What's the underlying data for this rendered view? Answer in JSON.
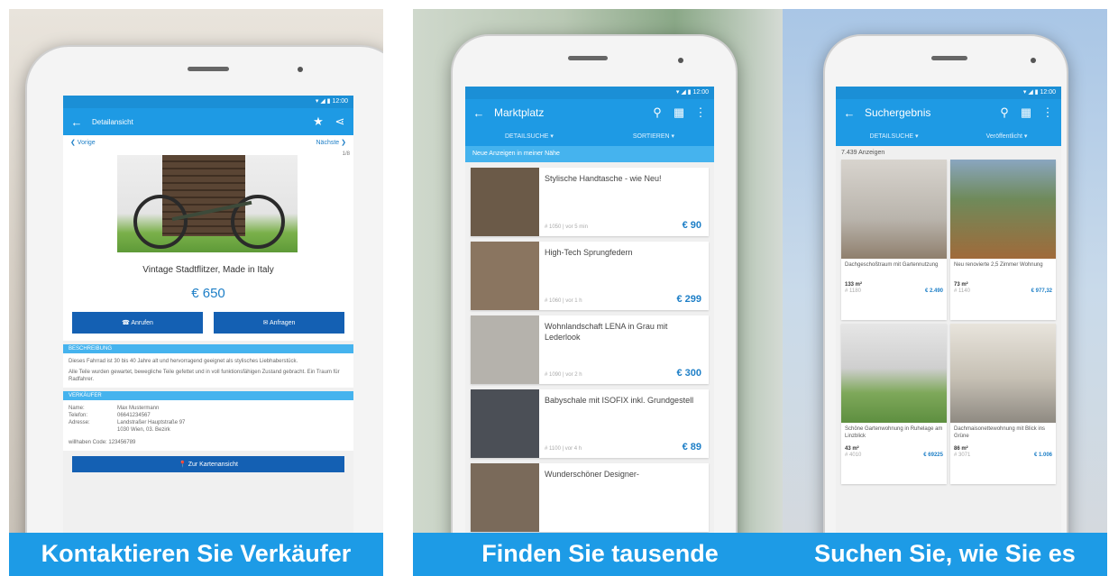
{
  "panels": [
    {
      "caption": "Kontaktieren Sie Verkäufer",
      "statusbar": "▾ ◢ ▮ 12:00",
      "toolbar": {
        "title": "Detailansicht"
      },
      "nav": {
        "prev": "❮ Vorige",
        "next": "Nächste ❯",
        "counter": "1/8"
      },
      "title": "Vintage Stadtflitzer, Made in Italy",
      "price": "€ 650",
      "buttons": {
        "call": "☎ Anrufen",
        "mail": "✉ Anfragen"
      },
      "section1": "BESCHREIBUNG",
      "description": [
        "Dieses Fahrrad ist 30 bis 40 Jahre alt und hervorragend geeignet als stylisches Liebhaberstück.",
        "Alle Teile wurden gewartet, bewegliche Teile gefettet und in voll funktionsfähigen Zustand gebracht. Ein Traum für Radfahrer."
      ],
      "section2": "VERKÄUFER",
      "seller": [
        [
          "Name:",
          "Max Mustermann"
        ],
        [
          "Telefon:",
          "06641234567"
        ],
        [
          "Adresse:",
          "Landstraßer Hauptstraße 97"
        ],
        [
          "",
          "1030 Wien, 03. Bezirk"
        ]
      ],
      "code": "willhaben Code: 123456789",
      "map_button": "📍 Zur Kartenansicht"
    },
    {
      "caption": "Finden Sie tausende",
      "statusbar": "▾ ◢ ▮ 12:00",
      "toolbar": {
        "title": "Marktplatz"
      },
      "tabs": [
        "DETAILSUCHE ▾",
        "SORTIEREN ▾"
      ],
      "hint": "Neue Anzeigen in meiner Nähe",
      "items": [
        {
          "title": "Stylische Handtasche - wie Neu!",
          "meta": "# 1050 | vor 5 min",
          "price": "€ 90",
          "color": "#6b5a48"
        },
        {
          "title": "High-Tech Sprungfedern",
          "meta": "# 1060 | vor 1 h",
          "price": "€ 299",
          "color": "#8a7560"
        },
        {
          "title": "Wohnlandschaft LENA in Grau mit Lederlook",
          "meta": "# 1090 | vor 2 h",
          "price": "€ 300",
          "color": "#b5b2ac"
        },
        {
          "title": "Babyschale mit ISOFIX inkl. Grundgestell",
          "meta": "# 1100 | vor 4 h",
          "price": "€ 89",
          "color": "#4b4f56"
        },
        {
          "title": "Wunderschöner Designer-",
          "meta": "",
          "price": "",
          "color": "#7a6a5a"
        }
      ]
    },
    {
      "caption": "Suchen Sie, wie Sie es",
      "statusbar": "▾ ◢ ▮ 12:00",
      "toolbar": {
        "title": "Suchergebnis"
      },
      "tabs": [
        "DETAILSUCHE ▾",
        "Veröffentlicht ▾"
      ],
      "count": "7.439 Anzeigen",
      "items": [
        {
          "title": "Dachgeschoßtraum mit Gartennutzung",
          "area": "133 m²",
          "meta": "# 1180",
          "price": "€ 2.490",
          "color": "#b9b4ac"
        },
        {
          "title": "Neu renovierte 2,5 Zimmer Wohnung",
          "area": "73 m²",
          "meta": "# 1140",
          "price": "€ 977,32",
          "color": "#a06a3a"
        },
        {
          "title": "Schöne Gartenwohnung in Ruhelage am Linzblick",
          "area": "43 m²",
          "meta": "# 4010",
          "price": "€ 69225",
          "color": "#7ea85a"
        },
        {
          "title": "Dachmaisonettewohnung mit Blick ins Grüne",
          "area": "86 m²",
          "meta": "# 3071",
          "price": "€ 1.006",
          "color": "#c6c0b4"
        }
      ]
    }
  ]
}
